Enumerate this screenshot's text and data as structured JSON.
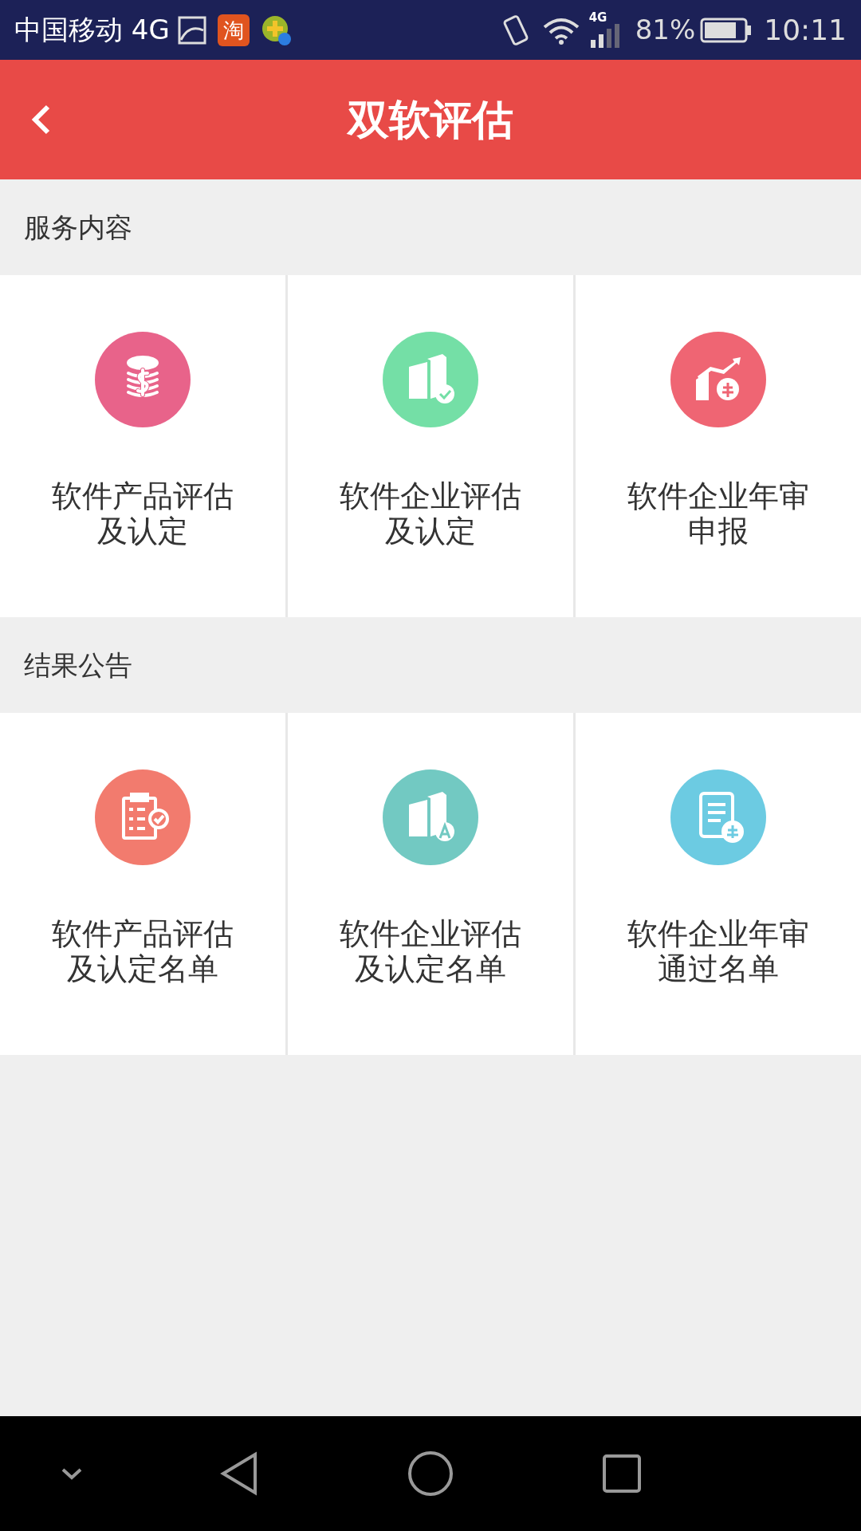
{
  "status_bar": {
    "carrier": "中国移动 4G",
    "app_badge": "淘",
    "network": "4G",
    "battery": "81%",
    "time": "10:11"
  },
  "header": {
    "title": "双软评估"
  },
  "sections": [
    {
      "title": "服务内容",
      "items": [
        {
          "kind": "coins",
          "color": "#e8638a",
          "label_lines": [
            "软件产品评估",
            "及认定"
          ]
        },
        {
          "kind": "building-check",
          "color": "#74dfa6",
          "label_lines": [
            "软件企业评估",
            "及认定"
          ]
        },
        {
          "kind": "chart-badge",
          "color": "#ef6573",
          "label_lines": [
            "软件企业年审",
            "申报"
          ]
        }
      ]
    },
    {
      "title": "结果公告",
      "items": [
        {
          "kind": "clipboard",
          "color": "#f27b6e",
          "label_lines": [
            "软件产品评估",
            "及认定名单"
          ]
        },
        {
          "kind": "building-badge",
          "color": "#72c9c2",
          "label_lines": [
            "软件企业评估",
            "及认定名单"
          ]
        },
        {
          "kind": "document",
          "color": "#6ccbe2",
          "label_lines": [
            "软件企业年审",
            "通过名单"
          ]
        }
      ]
    }
  ]
}
